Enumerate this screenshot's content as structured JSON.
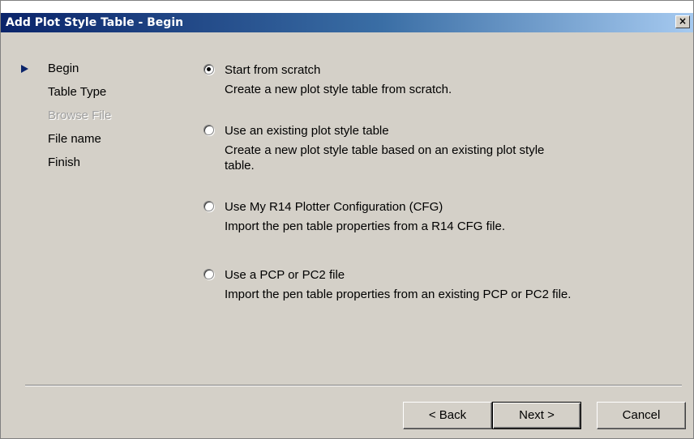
{
  "window": {
    "title": "Add Plot Style Table - Begin",
    "close_label": "×"
  },
  "steps": [
    {
      "label": "Begin",
      "current": true,
      "enabled": true
    },
    {
      "label": "Table Type",
      "current": false,
      "enabled": true
    },
    {
      "label": "Browse File",
      "current": false,
      "enabled": false
    },
    {
      "label": "File name",
      "current": false,
      "enabled": true
    },
    {
      "label": "Finish",
      "current": false,
      "enabled": true
    }
  ],
  "options": [
    {
      "label": "Start from scratch",
      "description": "Create a new plot style table from scratch.",
      "selected": true
    },
    {
      "label": "Use an existing plot style table",
      "description": "Create a new plot style table based on an existing plot style table.",
      "selected": false
    },
    {
      "label": "Use My R14 Plotter Configuration (CFG)",
      "description": "Import the pen table properties from a R14 CFG file.",
      "selected": false
    },
    {
      "label": "Use a PCP or PC2 file",
      "description": "Import the pen table properties from an existing PCP or PC2 file.",
      "selected": false
    }
  ],
  "buttons": {
    "back": "< Back",
    "next": "Next >",
    "cancel": "Cancel"
  },
  "colors": {
    "title_bar_start": "#0a246a",
    "title_bar_end": "#a6caf0",
    "dialog_face": "#d4d0c8",
    "disabled_text": "#a0a0a0"
  }
}
